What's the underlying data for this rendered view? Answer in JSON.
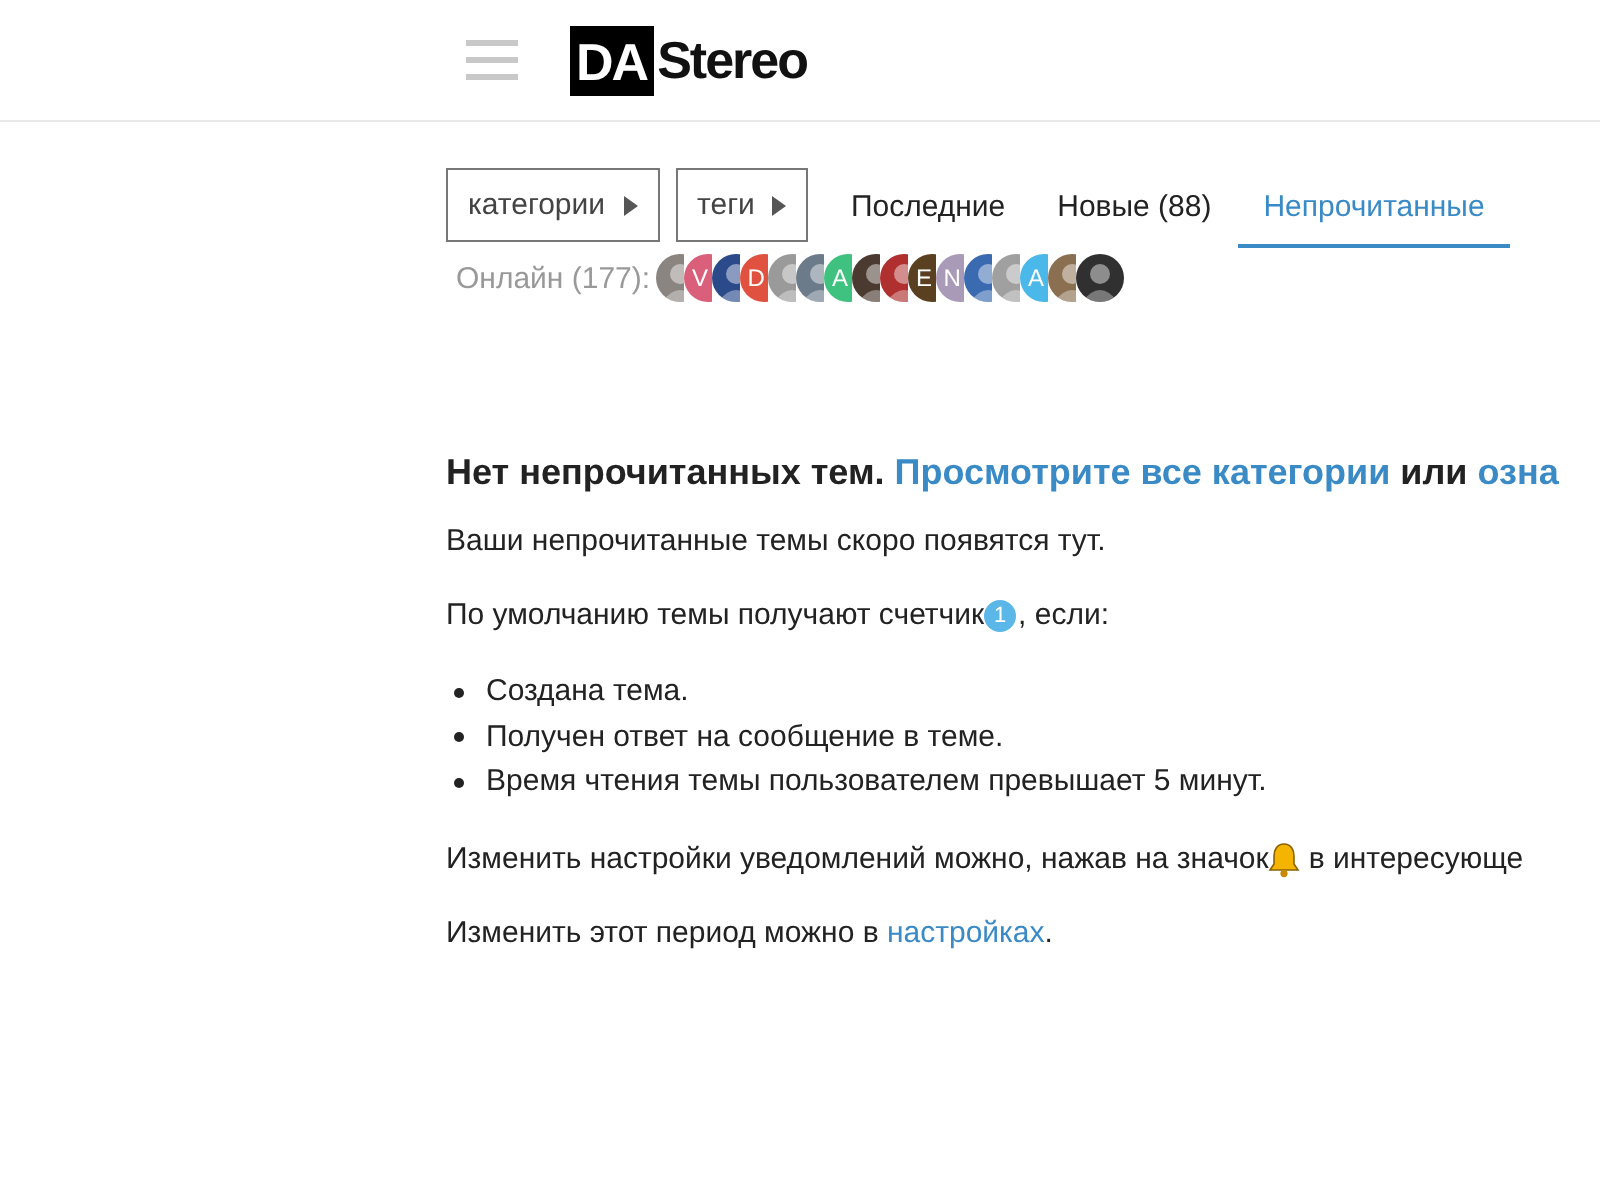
{
  "header": {
    "logo": {
      "box": "DA",
      "text": "Stereo"
    }
  },
  "nav": {
    "dropdowns": [
      {
        "label": "категории"
      },
      {
        "label": "теги"
      }
    ],
    "tabs": [
      {
        "label": "Последние",
        "selected": false
      },
      {
        "label": "Новые (88)",
        "selected": false
      },
      {
        "label": "Непрочитанные",
        "selected": true
      }
    ]
  },
  "online": {
    "label": "Онлайн (177):",
    "avatars": [
      {
        "kind": "photo",
        "color": "#8a8580"
      },
      {
        "kind": "letter",
        "letter": "V",
        "color": "#d95f7a"
      },
      {
        "kind": "photo",
        "color": "#2a4a8a"
      },
      {
        "kind": "letter",
        "letter": "D",
        "color": "#e0523f"
      },
      {
        "kind": "photo",
        "color": "#9a9a9a"
      },
      {
        "kind": "photo",
        "color": "#6b7b8a"
      },
      {
        "kind": "letter",
        "letter": "A",
        "color": "#3fc27f"
      },
      {
        "kind": "photo",
        "color": "#4a3a30"
      },
      {
        "kind": "photo",
        "color": "#b03030"
      },
      {
        "kind": "letter",
        "letter": "E",
        "color": "#5a4020"
      },
      {
        "kind": "letter",
        "letter": "N",
        "color": "#a99ab8"
      },
      {
        "kind": "photo",
        "color": "#3a6ab0"
      },
      {
        "kind": "photo",
        "color": "#a0a0a0"
      },
      {
        "kind": "letter",
        "letter": "A",
        "color": "#4ab8e8"
      },
      {
        "kind": "photo",
        "color": "#8a7050"
      },
      {
        "kind": "photo",
        "color": "#303030"
      }
    ]
  },
  "empty": {
    "heading": "Нет непрочитанных тем.",
    "link": "Просмотрите все категории",
    "joiner": "или",
    "link2": "озна",
    "intro": "Ваши непрочитанные темы скоро появятся тут.",
    "counter_before": "По умолчанию темы получают счетчик",
    "counter_badge": "1",
    "counter_after": ", если:",
    "conditions": [
      "Создана тема.",
      "Получен ответ на сообщение в теме.",
      "Время чтения темы пользователем превышает 5 минут."
    ],
    "notify_before": "Изменить настройки уведомлений можно, нажав на значок",
    "notify_after": "в интересующе",
    "period_before": "Изменить этот период можно в",
    "period_link": "настройках",
    "period_after": "."
  }
}
